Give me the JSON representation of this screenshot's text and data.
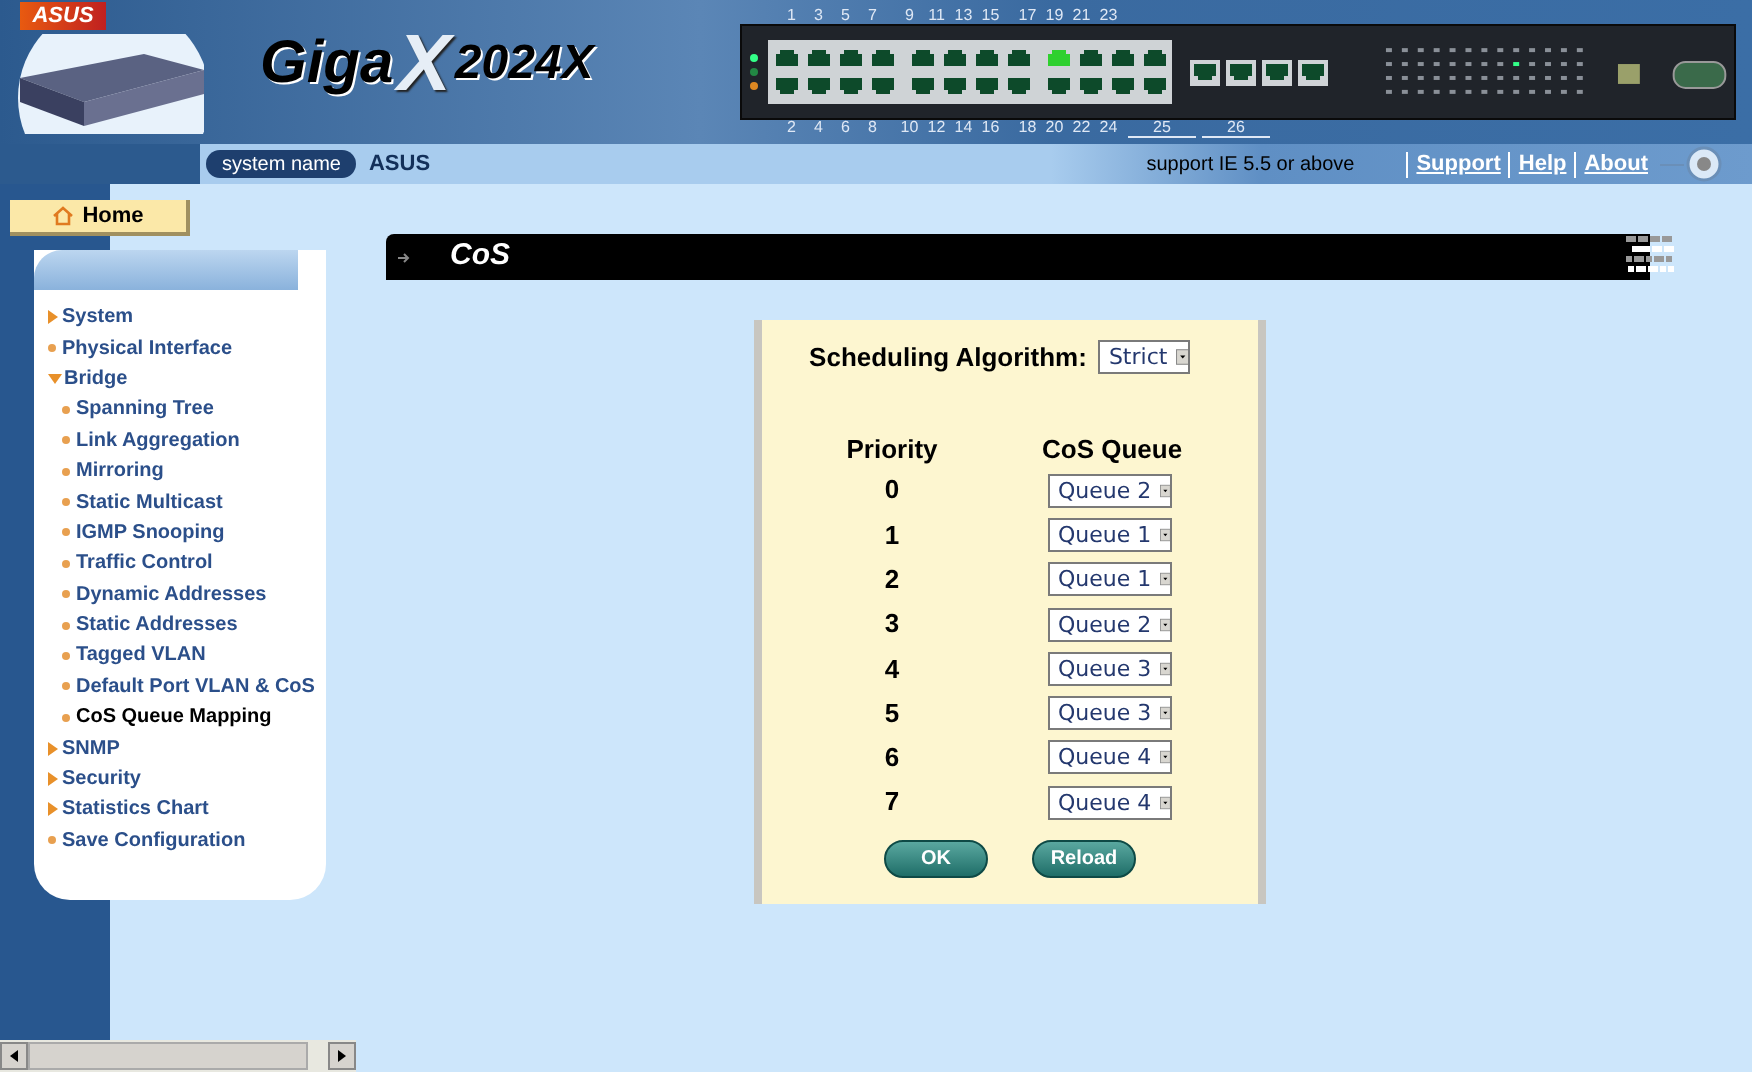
{
  "brand": {
    "vendor": "ASUS",
    "logo_left": "Giga",
    "logo_mark": "X",
    "logo_right": "2024X"
  },
  "switch_panel": {
    "top_ports": [
      "1",
      "3",
      "5",
      "7",
      "9",
      "11",
      "13",
      "15",
      "17",
      "19",
      "21",
      "23"
    ],
    "bottom_ports": [
      "2",
      "4",
      "6",
      "8",
      "10",
      "12",
      "14",
      "16",
      "18",
      "20",
      "22",
      "24"
    ],
    "uplinks": [
      "25",
      "26"
    ]
  },
  "info_bar": {
    "label": "system name",
    "value": "ASUS",
    "note": "support IE 5.5 or above",
    "links": [
      "Support",
      "Help",
      "About"
    ]
  },
  "home_tab": {
    "label": "Home"
  },
  "sidebar": {
    "items": [
      {
        "label": "System",
        "kind": "folder",
        "expanded": false,
        "selected": false
      },
      {
        "label": "Physical Interface",
        "kind": "leaf",
        "selected": false
      },
      {
        "label": "Bridge",
        "kind": "folder",
        "expanded": true,
        "selected": false,
        "children": [
          {
            "label": "Spanning Tree",
            "kind": "leaf",
            "selected": false
          },
          {
            "label": "Link Aggregation",
            "kind": "leaf",
            "selected": false
          },
          {
            "label": "Mirroring",
            "kind": "leaf",
            "selected": false
          },
          {
            "label": "Static Multicast",
            "kind": "leaf",
            "selected": false
          },
          {
            "label": "IGMP Snooping",
            "kind": "leaf",
            "selected": false
          },
          {
            "label": "Traffic Control",
            "kind": "leaf",
            "selected": false
          },
          {
            "label": "Dynamic Addresses",
            "kind": "leaf",
            "selected": false
          },
          {
            "label": "Static Addresses",
            "kind": "leaf",
            "selected": false
          },
          {
            "label": "Tagged VLAN",
            "kind": "leaf",
            "selected": false
          },
          {
            "label": "Default Port VLAN & CoS",
            "kind": "leaf",
            "selected": false
          },
          {
            "label": "CoS Queue Mapping",
            "kind": "leaf",
            "selected": true
          }
        ]
      },
      {
        "label": "SNMP",
        "kind": "folder",
        "expanded": false,
        "selected": false
      },
      {
        "label": "Security",
        "kind": "folder",
        "expanded": false,
        "selected": false
      },
      {
        "label": "Statistics Chart",
        "kind": "folder",
        "expanded": false,
        "selected": false
      },
      {
        "label": "Save Configuration",
        "kind": "leaf",
        "selected": false
      }
    ]
  },
  "page_title": "CoS",
  "form": {
    "scheduling_label": "Scheduling Algorithm:",
    "scheduling_value": "Strict",
    "columns": [
      "Priority",
      "CoS Queue"
    ],
    "rows": [
      {
        "priority": "0",
        "queue": "Queue 2"
      },
      {
        "priority": "1",
        "queue": "Queue 1"
      },
      {
        "priority": "2",
        "queue": "Queue 1"
      },
      {
        "priority": "3",
        "queue": "Queue 2"
      },
      {
        "priority": "4",
        "queue": "Queue 3"
      },
      {
        "priority": "5",
        "queue": "Queue 3"
      },
      {
        "priority": "6",
        "queue": "Queue 4"
      },
      {
        "priority": "7",
        "queue": "Queue 4"
      }
    ],
    "buttons": [
      "OK",
      "Reload"
    ]
  }
}
